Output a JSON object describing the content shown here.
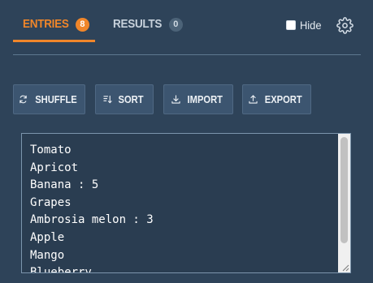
{
  "tabs": [
    {
      "label": "ENTRIES",
      "count": "8",
      "active": true
    },
    {
      "label": "RESULTS",
      "count": "0",
      "active": false
    }
  ],
  "hide": {
    "label": "Hide",
    "checked": false
  },
  "settings": {
    "icon": "gear-icon"
  },
  "toolbar": {
    "shuffle_label": "SHUFFLE",
    "sort_label": "SORT",
    "import_label": "IMPORT",
    "export_label": "EXPORT"
  },
  "entries": [
    "Tomato",
    "Apricot",
    "Banana : 5",
    "Grapes",
    "Ambrosia melon : 3",
    "Apple",
    "Mango",
    "Blueberry"
  ],
  "colors": {
    "background": "#2e4359",
    "accent": "#f0862a",
    "button_bg": "#3c5570",
    "text_area_bg": "#2a3d51"
  }
}
